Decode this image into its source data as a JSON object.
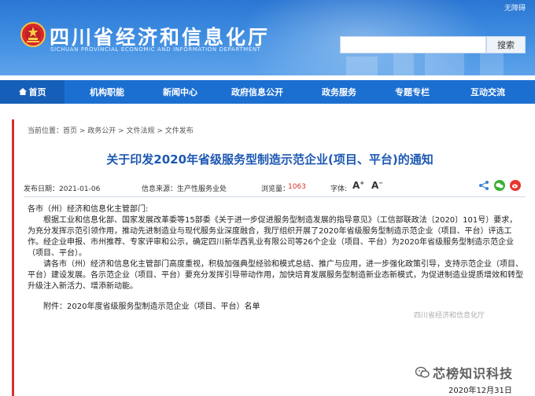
{
  "header": {
    "accessibility": "无障碍",
    "title_cn": "四川省经济和信息化厅",
    "title_en": "SICHUAN PROVINCIAL ECONOMIC AND INFORMATION DEPARTMENT",
    "search_button": "搜索",
    "search_value": ""
  },
  "nav": {
    "items": [
      "首页",
      "机构职能",
      "新闻中心",
      "政府信息公开",
      "政务服务",
      "专题专栏",
      "互动交流"
    ]
  },
  "breadcrumb": "当前位置：首页 > 政务公开 > 文件法规 > 文件发布",
  "article": {
    "title": "关于印发2020年省级服务型制造示范企业(项目、平台)的通知",
    "date": "发布日期：2021-01-06",
    "source": "信息来源：生产性服务业处",
    "views_label": "浏览量：",
    "views_value": "1063",
    "font_label": "字体:",
    "salutation": "各市（州）经济和信息化主管部门:",
    "paragraph1": "根据工业和信息化部、国家发展改革委等15部委《关于进一步促进服务型制造发展的指导意见》（工信部联政法〔2020〕101号）要求，为充分发挥示范引领作用，推动先进制造业与现代服务业深度融合，我厅组织开展了2020年省级服务型制造示范企业（项目、平台）评选工作。经企业申报、市州推荐、专家评审和公示，确定四川新华西乳业有限公司等26个企业（项目、平台）为2020年省级服务型制造示范企业（项目、平台）。",
    "paragraph2": "请各市（州）经济和信息化主管部门高度重视，积极加强典型经验和模式总结、推广与应用，进一步强化政策引导，支持示范企业（项目、平台）建设发展。各示范企业（项目、平台）要充分发挥引导带动作用，加快培育发展服务型制造新业态新模式，为促进制造业提质增效和转型升级注入新活力、增添新动能。",
    "attachment": "附件：2020年度省级服务型制造示范企业（项目、平台）名单",
    "issuer": "四川省经济和信息化厅",
    "sign_date": "2020年12月31日",
    "watermark": "芯榜知识科技"
  },
  "colors": {
    "nav_bg": "#1b6fd1",
    "title_blue": "#1d58b3",
    "accent_red": "#d43030"
  }
}
